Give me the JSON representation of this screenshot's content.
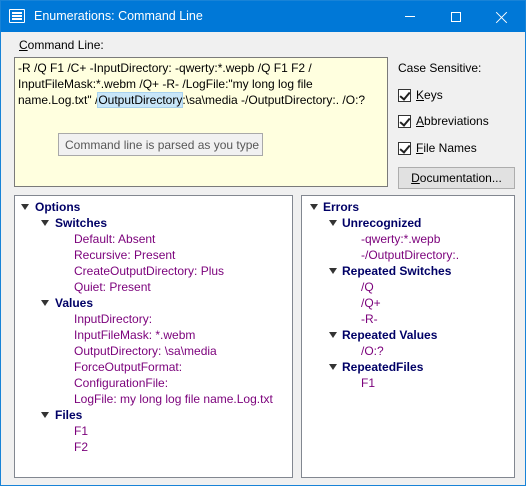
{
  "window": {
    "title": "Enumerations: Command Line"
  },
  "command_line": {
    "label_accel": "C",
    "label_rest": "ommand Line:",
    "text_before": "-R /Q F1 /C+ -InputDirectory: -qwerty:*.wepb /Q F1 F2 / InputFileMask:*.webm /Q+ -R- /LogFile:\"my long log file name.Log.txt\" /",
    "text_selected": "OutputDirectory",
    "text_after": ":\\sa\\media -/OutputDirectory:. /O:?",
    "tooltip": "Command line is parsed as you type"
  },
  "options_panel": {
    "case_label": "Case Sensitive:",
    "keys": {
      "accel": "K",
      "rest": "eys",
      "checked": true
    },
    "abbreviations": {
      "accel": "A",
      "rest": "bbreviations",
      "checked": true
    },
    "file_names": {
      "accel": "F",
      "rest": "ile Names",
      "checked": true
    },
    "documentation_button": {
      "accel": "D",
      "rest": "ocumentation..."
    }
  },
  "options_tree": {
    "root": "Options",
    "switches": {
      "label": "Switches",
      "items": [
        "Default: Absent",
        "Recursive: Present",
        "CreateOutputDirectory: Plus",
        "Quiet: Present"
      ]
    },
    "values": {
      "label": "Values",
      "items": [
        "InputDirectory:",
        "InputFileMask: *.webm",
        "OutputDirectory: \\sa\\media",
        "ForceOutputFormat:",
        "ConfigurationFile:",
        "LogFile: my long log file name.Log.txt"
      ]
    },
    "files": {
      "label": "Files",
      "items": [
        "F1",
        "F2"
      ]
    }
  },
  "errors_tree": {
    "root": "Errors",
    "unrecognized": {
      "label": "Unrecognized",
      "items": [
        "-qwerty:*.wepb",
        "-/OutputDirectory:."
      ]
    },
    "repeated_switches": {
      "label": "Repeated Switches",
      "items": [
        "/Q",
        "/Q+",
        "-R-"
      ]
    },
    "repeated_values": {
      "label": "Repeated Values",
      "items": [
        "/O:?"
      ]
    },
    "repeated_files": {
      "label": "RepeatedFiles",
      "items": [
        "F1"
      ]
    }
  },
  "colors": {
    "titlebar": "#0078d7",
    "command_background": "#ffffdf",
    "group_text": "#000066",
    "leaf_text": "#7b007b",
    "selection": "#c8e6f8"
  }
}
